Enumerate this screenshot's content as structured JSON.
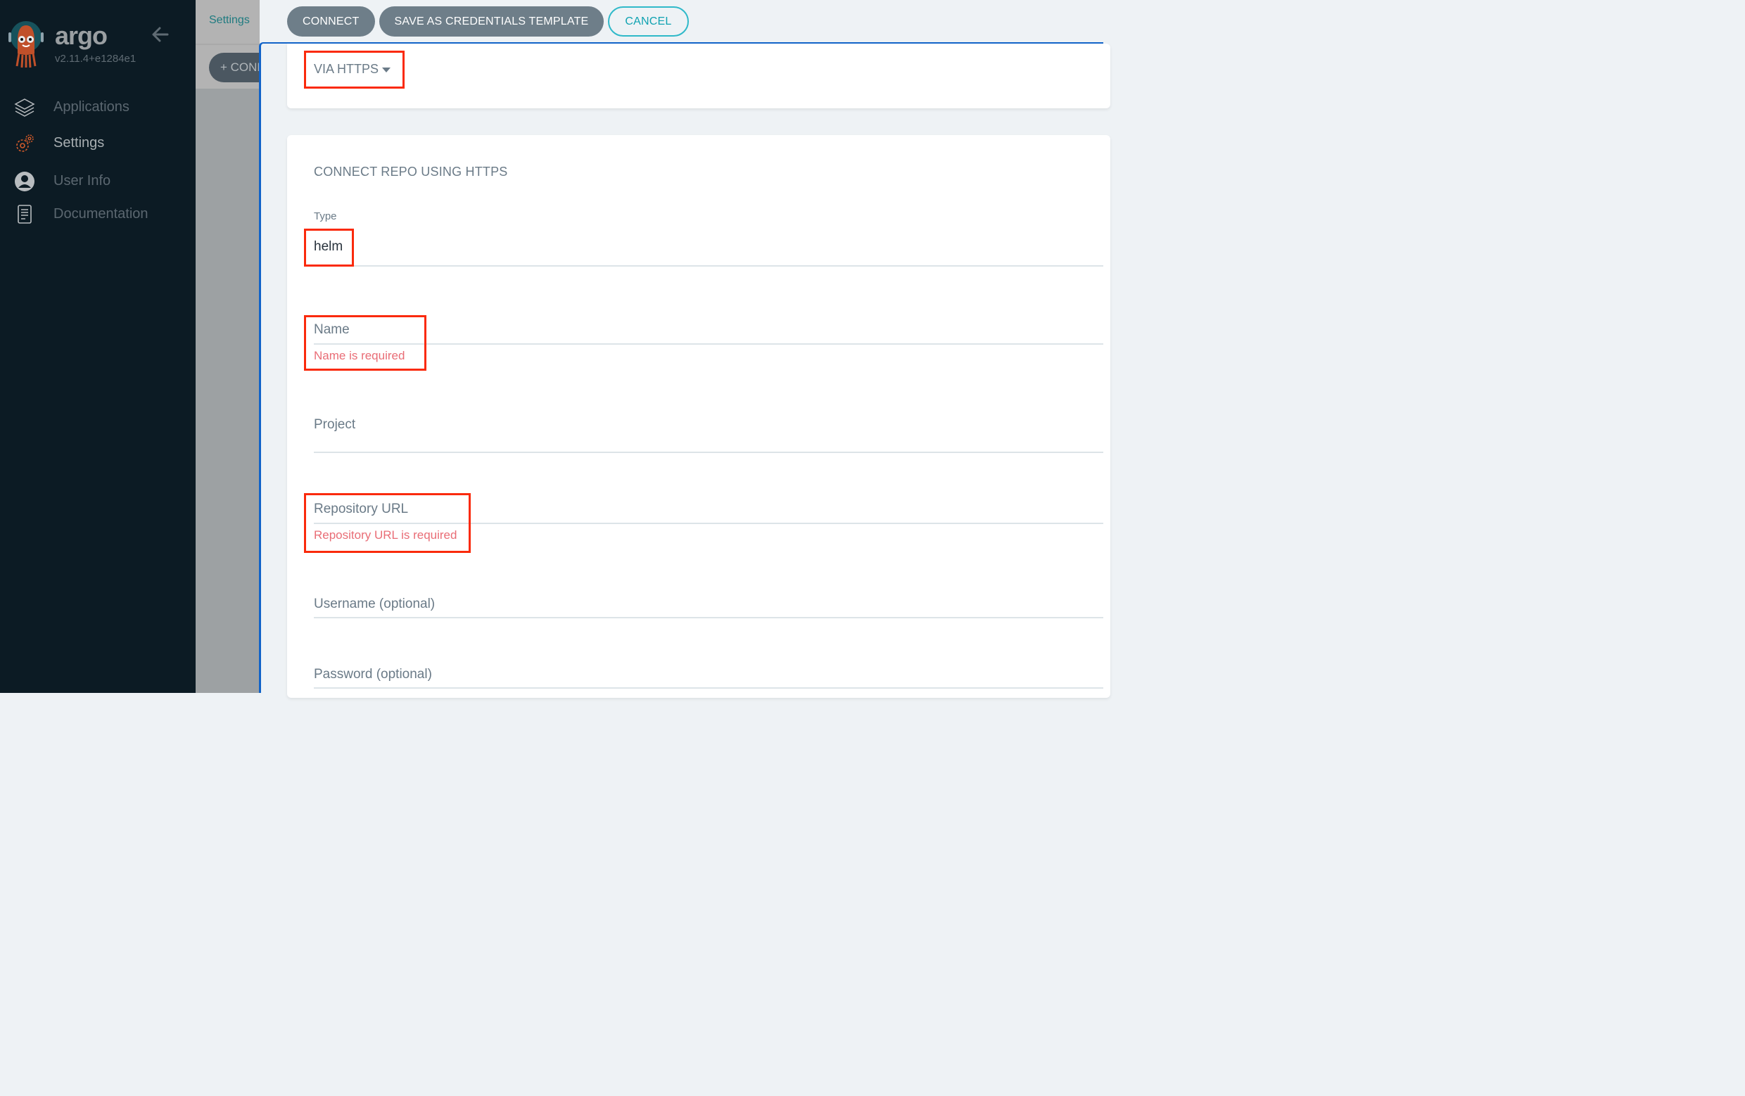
{
  "sidebar": {
    "brand": "argo",
    "version": "v2.11.4+e1284e1",
    "collapse_icon": "arrow-left-icon",
    "items": [
      {
        "label": "Applications",
        "icon": "layers-icon",
        "active": false
      },
      {
        "label": "Settings",
        "icon": "gears-icon",
        "active": true
      },
      {
        "label": "User Info",
        "icon": "user-circle-icon",
        "active": false
      },
      {
        "label": "Documentation",
        "icon": "book-icon",
        "active": false
      }
    ]
  },
  "background_page": {
    "breadcrumb": "Settings",
    "add_button": "+ CONNECT REPO"
  },
  "panel": {
    "buttons": {
      "connect": "CONNECT",
      "save_template": "SAVE AS CREDENTIALS TEMPLATE",
      "cancel": "CANCEL"
    },
    "method_dropdown": "VIA HTTPS",
    "section_title": "CONNECT REPO USING HTTPS",
    "fields": {
      "type": {
        "label": "Type",
        "value": "helm"
      },
      "name": {
        "placeholder": "Name",
        "error": "Name is required"
      },
      "project": {
        "placeholder": "Project"
      },
      "repo_url": {
        "placeholder": "Repository URL",
        "error": "Repository URL is required"
      },
      "username": {
        "placeholder": "Username (optional)"
      },
      "password": {
        "placeholder": "Password (optional)"
      }
    }
  },
  "colors": {
    "sidebar_bg": "#0c1b24",
    "accent_teal": "#0fa2b1",
    "button_gray": "#6e7e89",
    "error_red": "#e96d76",
    "highlight_red": "#fa2a0c",
    "panel_border_blue": "#1163c8"
  }
}
